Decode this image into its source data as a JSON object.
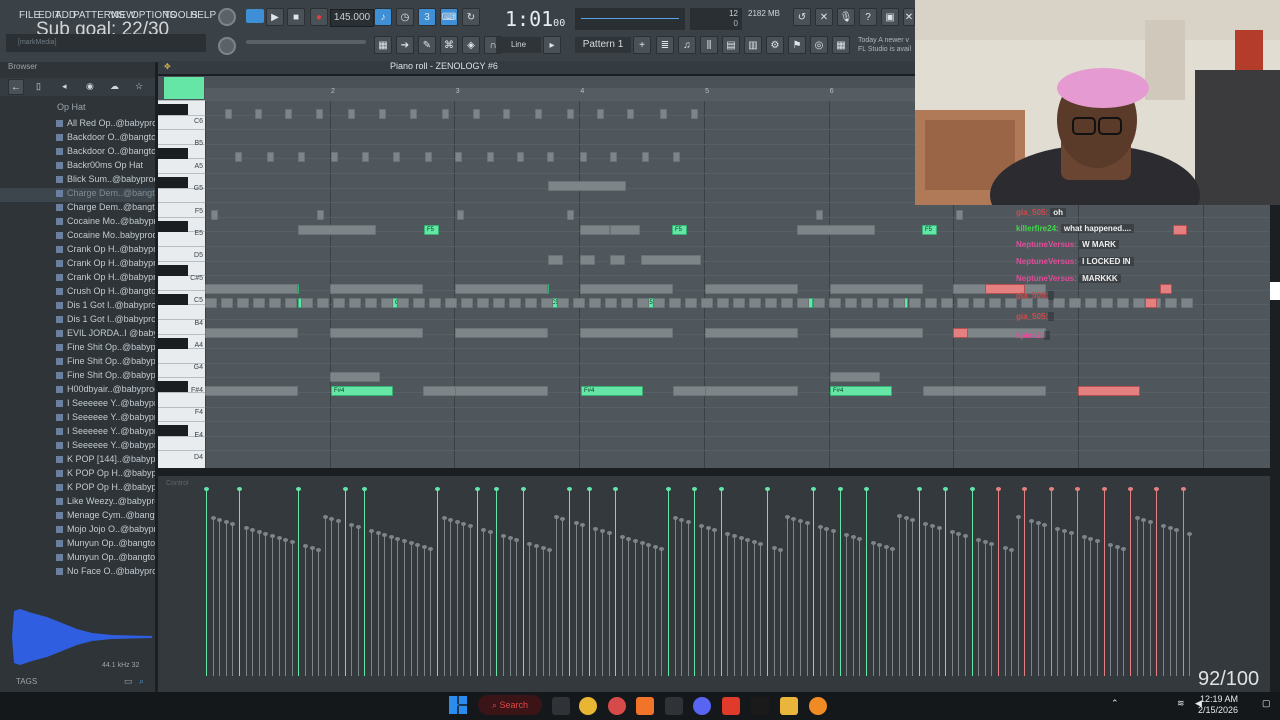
{
  "menu": [
    "FILE",
    "EDIT",
    "ADD",
    "PATTERNS",
    "VIEW",
    "OPTIONS",
    "TOOLS",
    "HELP"
  ],
  "overlay": {
    "sub_goal": "Sub goal: 22/30",
    "score": "92/100"
  },
  "transport": {
    "tempo": "145.000",
    "time": "1:01",
    "time_sub": "00",
    "snap": "Line",
    "pattern": "Pattern 1",
    "cpu": "12",
    "mem": "2182 MB",
    "mem2": "0"
  },
  "hint": {
    "line1": "Today  A newer v",
    "line2": "FL Studio is avail"
  },
  "browser": {
    "title": "Browser",
    "folder": "Op Hat",
    "search_placeholder": "[markMedia]",
    "items": [
      "All Red Op..@babyprod",
      "Backdoor O..@bangtozy",
      "Backdoor O..@bangtozy",
      "Backr00ms Op Hat",
      "Blick Sum..@babyprod",
      "Charge Dem..@bangtozy",
      "Charge Dem..@bangtozy",
      "Cocaine Mo..@babyprod",
      "Cocaine Mo..babyprod",
      "Crank Op H..@babyprod",
      "Crank Op H..@babyprod",
      "Crank Op H..@babyprod",
      "Crush Op H..@bangtozy",
      "Dis 1 Got I..@babyprod",
      "Dis 1 Got I..@babyprod",
      "EVIL JORDA..I @babyprod",
      "Fine Shit Op..@babyprod",
      "Fine Shit Op..@babyprod",
      "Fine Shit Op..@babyprod",
      "H00dbyair..@babyprod",
      "I Seeeeee Y..@babyprod",
      "I Seeeeee Y..@babyprod",
      "I Seeeeee Y..@babyprod",
      "I Seeeeee Y..@babyprod",
      "K POP [144]..@babyprod",
      "K POP Op H..@babyprod",
      "K POP Op H..@babyprod",
      "Like Weezy..@babyprod",
      "Menage Cym..@bangtozy",
      "Mojo Jojo O..@babyprod",
      "Munyun Op..@bangtozy",
      "Munyun Op..@bangtozy",
      "No Face O..@babyprod"
    ],
    "selected_index": 5,
    "sample_info": "44.1 kHz 32",
    "tags_label": "TAGS"
  },
  "piano_roll": {
    "title": "Piano roll - ZENOLOGY #6",
    "ruler": [
      "2",
      "3",
      "4",
      "5",
      "6"
    ],
    "key_labels": [
      "C6",
      "B5",
      "A5",
      "G5",
      "F5",
      "E5",
      "D5",
      "C#5",
      "C5",
      "B4",
      "A4",
      "G4",
      "F#4",
      "F4",
      "E4",
      "D4"
    ],
    "note_labels": {
      "f5": "F5",
      "cs5": "C#5",
      "c5": "C5",
      "a4": "A#4",
      "fs4": "F#4"
    }
  },
  "velocity": {
    "label": "Control"
  },
  "chat": [
    {
      "user": "gia_505",
      "text": "oh",
      "color": "#d14a4a"
    },
    {
      "user": "killerfire24",
      "text": "what happened....",
      "color": "#42d64a"
    },
    {
      "user": "NeptuneVersus",
      "text": "W MARK",
      "color": "#e04d9a"
    },
    {
      "user": "NeptuneVersus",
      "text": "I LOCKED IN",
      "color": "#e04d9a"
    },
    {
      "user": "NeptuneVersus",
      "text": "MARKKK",
      "color": "#e04d9a"
    },
    {
      "user": "gia_505",
      "text": "",
      "color": "#d14a4a"
    },
    {
      "user": "gia_505",
      "text": "",
      "color": "#d14a4a"
    },
    {
      "user": "kpies2",
      "text": "",
      "color": "#e04d9a"
    }
  ],
  "taskbar": {
    "search": "Search",
    "time": "12:19 AM",
    "date": "2/15/2026"
  },
  "colors": {
    "accent_note": "#65e6a7",
    "ghost_note": "#7d8589",
    "pink_note": "#e58080"
  }
}
